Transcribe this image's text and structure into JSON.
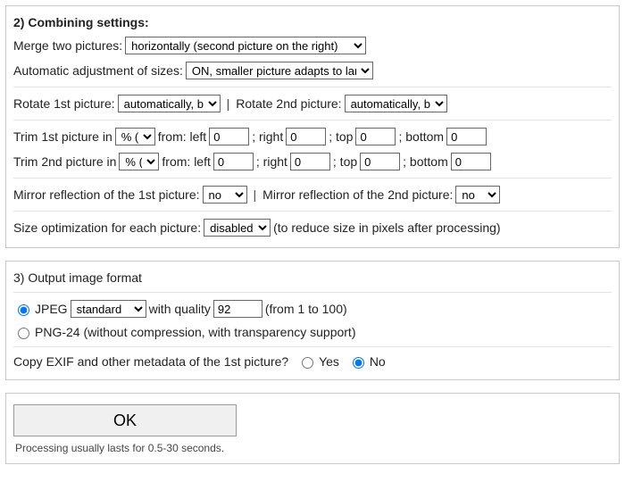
{
  "section2": {
    "title": "2) Combining settings:",
    "merge_label": "Merge two pictures:",
    "merge_value": "horizontally (second picture on the right)",
    "auto_label": "Automatic adjustment of sizes:",
    "auto_value": "ON, smaller picture adapts to lar",
    "rotate1_label": "Rotate 1st picture:",
    "rotate1_value": "automatically, b",
    "rotate2_label": "Rotate 2nd picture:",
    "rotate2_value": "automatically, b",
    "trim1_label": "Trim 1st picture in",
    "trim2_label": "Trim 2nd picture in",
    "trim_unit": "% (",
    "trim_from": "from: left",
    "trim_right": "; right",
    "trim_top": "; top",
    "trim_bottom": "; bottom",
    "trim1": {
      "left": "0",
      "right": "0",
      "top": "0",
      "bottom": "0"
    },
    "trim2": {
      "left": "0",
      "right": "0",
      "top": "0",
      "bottom": "0"
    },
    "mirror1_label": "Mirror reflection of the 1st picture:",
    "mirror1_value": "no",
    "mirror2_label": "Mirror reflection of the 2nd picture:",
    "mirror2_value": "no",
    "sizeopt_label": "Size optimization for each picture:",
    "sizeopt_value": "disabled (",
    "sizeopt_note": "(to reduce size in pixels after processing)"
  },
  "section3": {
    "title": "3) Output image format",
    "jpeg_label": "JPEG",
    "jpeg_profile": "standard",
    "quality_label": "with quality",
    "quality_value": "92",
    "quality_range": "(from 1 to 100)",
    "png_label": "PNG-24 (without compression, with transparency support)",
    "exif_label": "Copy EXIF and other metadata of the 1st picture?",
    "yes": "Yes",
    "no": "No"
  },
  "footer": {
    "ok": "OK",
    "note": "Processing usually lasts for 0.5-30 seconds."
  }
}
